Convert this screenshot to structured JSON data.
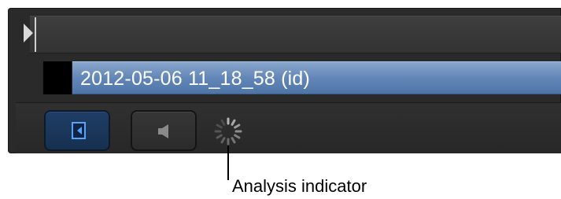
{
  "clip": {
    "title": "2012-05-06 11_18_58 (id)"
  },
  "toolbar": {
    "video_button_icon": "video-icon",
    "audio_button_icon": "speaker-icon",
    "status_icon": "spinner-icon"
  },
  "callout": {
    "label": "Analysis indicator"
  },
  "colors": {
    "panel_bg": "#2a2a2a",
    "clip_blue": "#6286b7",
    "accent_blue": "#5aa0ff",
    "label_text": "#000000"
  }
}
